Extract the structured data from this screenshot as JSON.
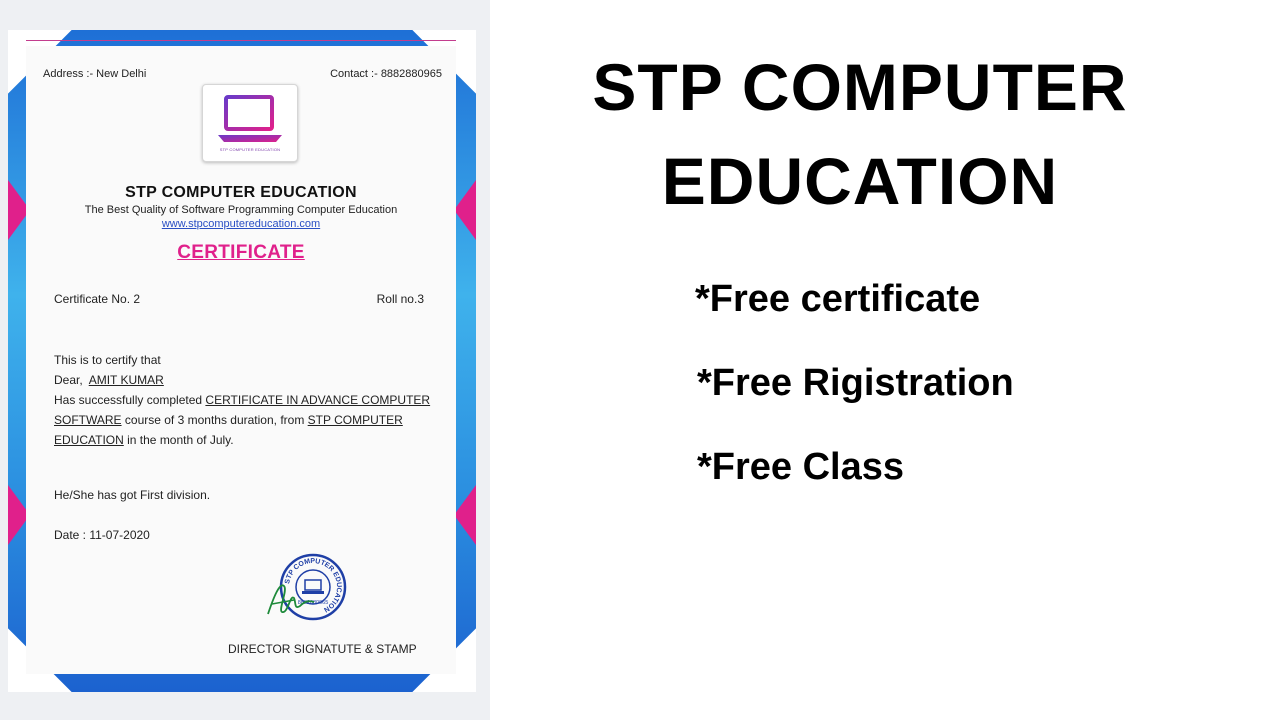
{
  "certificate": {
    "address": "Address :- New Delhi",
    "contact": "Contact :- 8882880965",
    "logo_caption": "STP COMPUTER EDUCATION",
    "org_name": "STP COMPUTER EDUCATION",
    "tagline": "The Best Quality of Software Programming Computer Education",
    "website": "www.stpcomputereducation.com",
    "title": "CERTIFICATE",
    "certificate_no": "Certificate No. 2",
    "roll_no": "Roll no.3",
    "line_certify": "This is to certify that",
    "dear_label": "Dear,",
    "student_name": "AMIT KUMAR",
    "completed_prefix": "Has successfully completed",
    "course_name": "CERTIFICATE IN ADVANCE COMPUTER SOFTWARE",
    "course_mid": "course of 3 months duration, from",
    "institute": "STP COMPUTER EDUCATION",
    "course_suffix": "in the month of July.",
    "division": "He/She has got First division.",
    "date": "Date : 11-07-2020",
    "stamp_text": "STP COMPUTER EDUCATION",
    "stamp_phone": "8882880965",
    "director": "DIRECTOR SIGNATUTE & STAMP"
  },
  "heading": {
    "line1": "STP COMPUTER",
    "line2": "EDUCATION"
  },
  "features": [
    "*Free certificate",
    "*Free Rigistration",
    "*Free Class"
  ],
  "colors": {
    "pink": "#e0208b",
    "frame_blue": "#2b8fe0",
    "link_blue": "#2a4fc4"
  }
}
